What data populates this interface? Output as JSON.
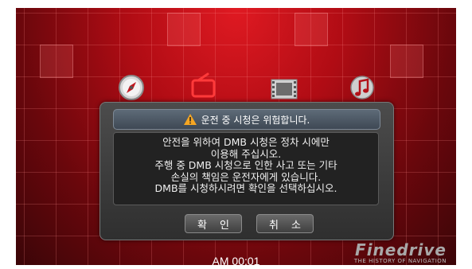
{
  "dialog": {
    "title": "운전 중 시청은 위험합니다.",
    "lines": [
      "안전을 위하여 DMB 시청은 정차 시에만",
      "이용해 주십시오.",
      "주행 중 DMB 시청으로 인한 사고 또는 기타",
      "손실의 책임은 운전자에게 있습니다.",
      "DMB를 시청하시려면 확인을 선택하십시오."
    ],
    "confirm_label": "확 인",
    "cancel_label": "취 소"
  },
  "status": {
    "time": "AM 00:01"
  },
  "brand": {
    "name": "Finedrive",
    "tagline": "THE HISTORY OF NAVIGATION"
  },
  "menu_icons": [
    "compass-icon",
    "tv-icon",
    "film-icon",
    "music-note-icon"
  ],
  "colors": {
    "background": "#b00c14",
    "dialog": "#3a3a3a",
    "warning": "#f5a623"
  }
}
